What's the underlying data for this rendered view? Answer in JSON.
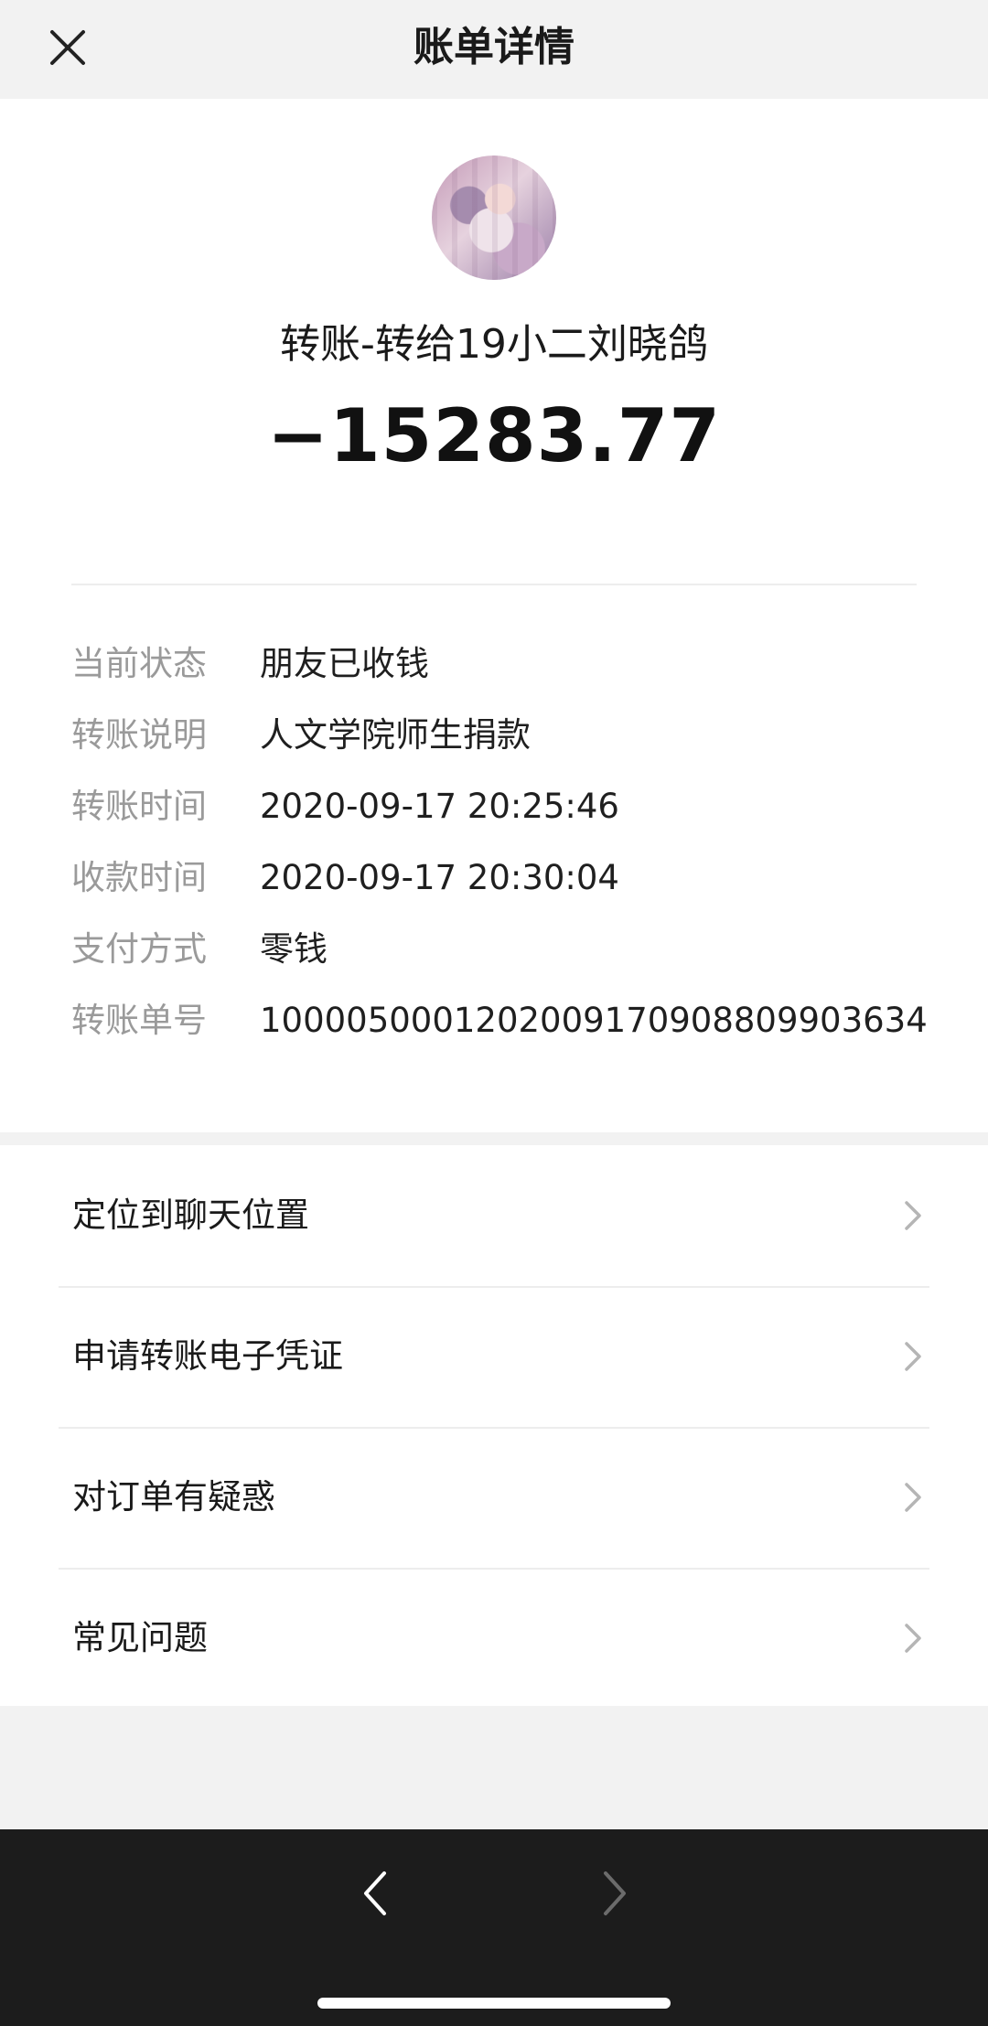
{
  "header": {
    "title": "账单详情",
    "close_icon": "close-icon"
  },
  "transfer": {
    "title": "转账-转给19小二刘晓鸽",
    "amount": "−15283.77"
  },
  "details": [
    {
      "label": "当前状态",
      "value": "朋友已收钱"
    },
    {
      "label": "转账说明",
      "value": "人文学院师生捐款"
    },
    {
      "label": "转账时间",
      "value": "2020-09-17 20:25:46"
    },
    {
      "label": "收款时间",
      "value": "2020-09-17 20:30:04"
    },
    {
      "label": "支付方式",
      "value": "零钱"
    },
    {
      "label": "转账单号",
      "value": "1000050001202009170908809903634"
    }
  ],
  "menu": [
    {
      "label": "定位到聊天位置",
      "icon": "chevron-right-icon"
    },
    {
      "label": "申请转账电子凭证",
      "icon": "chevron-right-icon"
    },
    {
      "label": "对订单有疑惑",
      "icon": "chevron-right-icon"
    },
    {
      "label": "常见问题",
      "icon": "chevron-right-icon"
    }
  ],
  "bottom_nav": {
    "back_icon": "nav-back-icon",
    "forward_icon": "nav-forward-icon"
  },
  "colors": {
    "background": "#f2f2f2",
    "card": "#ffffff",
    "label_gray": "#9a9a9a",
    "text": "#1a1a1a",
    "navbar": "#1c1c1c"
  }
}
